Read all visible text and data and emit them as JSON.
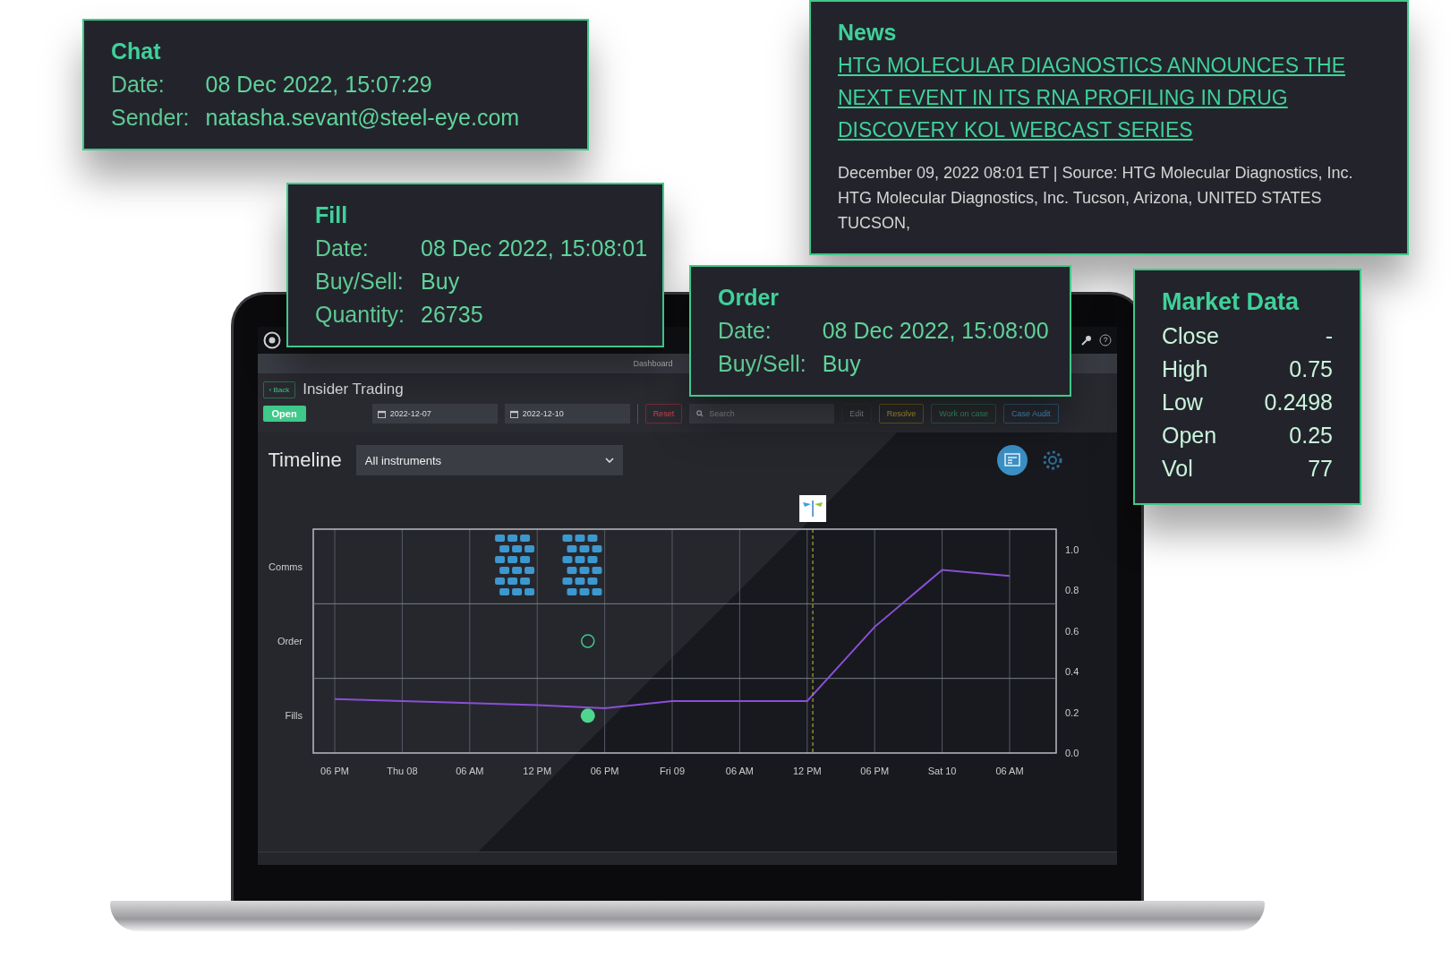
{
  "app": {
    "nav_item": "Dashboard",
    "case": {
      "back": "‹ Back",
      "title": "Insider Trading",
      "status": "Open"
    },
    "toolbar": {
      "date_from": "2022-12-07",
      "date_to": "2022-12-10",
      "search_placeholder": "Search",
      "buttons": [
        {
          "label": "Reset",
          "kind": "reset",
          "disabled": false
        },
        {
          "label": "Edit",
          "kind": "edit",
          "disabled": true
        },
        {
          "label": "Resolve",
          "kind": "resolve",
          "disabled": false
        },
        {
          "label": "Work on case",
          "kind": "work",
          "disabled": false
        },
        {
          "label": "Case Audit",
          "kind": "audit",
          "disabled": false
        }
      ]
    },
    "timeline": {
      "title": "Timeline",
      "instrument": "All instruments",
      "lanes": [
        "Comms",
        "Order",
        "Fills"
      ],
      "chart_data": {
        "type": "line",
        "categories": [
          "06 PM",
          "Thu 08",
          "06 AM",
          "12 PM",
          "06 PM",
          "Fri 09",
          "06 AM",
          "12 PM",
          "06 PM",
          "Sat 10",
          "06 AM"
        ],
        "series": [
          {
            "color": "#8a4fd6",
            "values": [
              0.265,
              0.255,
              0.245,
              0.235,
              0.22,
              0.255,
              0.255,
              0.255,
              0.62,
              0.9,
              0.87
            ]
          }
        ],
        "ylim": [
          0,
          1.1
        ],
        "grid": true,
        "ref_lines": [
          {
            "axis": "y",
            "value": 0.3667,
            "color": "#7a7f8a"
          },
          {
            "axis": "y",
            "value": 0.7333,
            "color": "#7a7f8a"
          }
        ],
        "yticks": [
          {
            "value": 0,
            "label": "0.0"
          },
          {
            "value": 0.2,
            "label": "0.2"
          },
          {
            "value": 0.4,
            "label": "0.4"
          },
          {
            "value": 0.6,
            "label": "0.6"
          },
          {
            "value": 0.8,
            "label": "0.8"
          },
          {
            "value": 1,
            "label": "1.0"
          }
        ]
      }
    }
  },
  "cards": [
    {
      "kind": "fields",
      "title": "Chat",
      "rows": [
        {
          "label": "Date:",
          "value": "08 Dec 2022, 15:07:29"
        },
        {
          "label": "Sender:",
          "value": "natasha.sevant@steel-eye.com"
        }
      ]
    },
    {
      "kind": "fields",
      "title": "Fill",
      "rows": [
        {
          "label": "Date:",
          "value": "08 Dec 2022, 15:08:01"
        },
        {
          "label": "Buy/Sell:",
          "value": "Buy"
        },
        {
          "label": "Quantity:",
          "value": "26735"
        }
      ]
    },
    {
      "kind": "news",
      "title": "News",
      "headline": "HTG MOLECULAR DIAGNOSTICS ANNOUNCES THE NEXT EVENT IN ITS RNA PROFILING IN DRUG DISCOVERY KOL WEBCAST SERIES",
      "lines": [
        "December 09, 2022 08:01 ET | Source: HTG Molecular Diagnostics, Inc.",
        "HTG Molecular Diagnostics, Inc. Tucson, Arizona, UNITED STATES",
        "TUCSON,"
      ]
    },
    {
      "kind": "fields",
      "title": "Order",
      "rows": [
        {
          "label": "Date:",
          "value": "08 Dec 2022, 15:08:00"
        },
        {
          "label": "Buy/Sell:",
          "value": "Buy"
        }
      ]
    },
    {
      "kind": "quotes",
      "title": "Market Data",
      "rows": [
        {
          "label": "Close",
          "value": "-"
        },
        {
          "label": "High",
          "value": "0.75"
        },
        {
          "label": "Low",
          "value": "0.2498"
        },
        {
          "label": "Open",
          "value": "0.25"
        },
        {
          "label": "Vol",
          "value": "77"
        }
      ]
    }
  ]
}
